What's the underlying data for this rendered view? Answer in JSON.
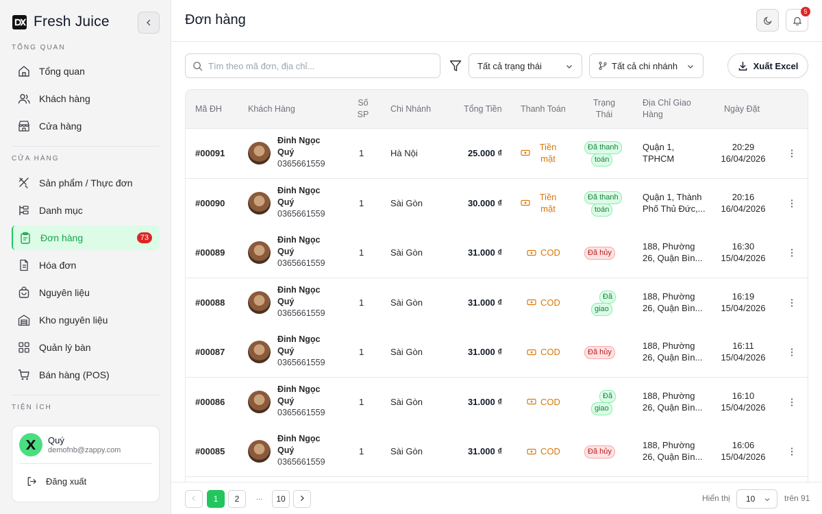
{
  "brand": {
    "name": "Fresh Juice"
  },
  "sidebar": {
    "sections": [
      "Tổng quan",
      "Cửa hàng",
      "Tiện ích"
    ],
    "overview_items": [
      {
        "label": "Tổng quan",
        "icon": "home-icon"
      },
      {
        "label": "Khách hàng",
        "icon": "users-icon"
      },
      {
        "label": "Cửa hàng",
        "icon": "store-icon"
      }
    ],
    "store_items": [
      {
        "label": "Sản phẩm / Thực đơn",
        "icon": "utensils-icon"
      },
      {
        "label": "Danh mục",
        "icon": "category-icon"
      },
      {
        "label": "Đơn hàng",
        "icon": "clipboard-icon",
        "active": true,
        "badge": "73"
      },
      {
        "label": "Hóa đơn",
        "icon": "invoice-icon"
      },
      {
        "label": "Nguyên liệu",
        "icon": "bag-icon"
      },
      {
        "label": "Kho nguyên liệu",
        "icon": "warehouse-icon"
      },
      {
        "label": "Quản lý bàn",
        "icon": "grid-icon"
      },
      {
        "label": "Bán hàng (POS)",
        "icon": "cart-icon"
      }
    ]
  },
  "user": {
    "name": "Quý",
    "email": "demofnb@zappy.com",
    "logout_label": "Đăng xuất"
  },
  "header": {
    "title": "Đơn hàng",
    "notification_count": "5"
  },
  "toolbar": {
    "search_placeholder": "Tìm theo mã đơn, địa chỉ...",
    "status_filter": "Tất cả trạng thái",
    "branch_filter": "Tất cả chi nhánh",
    "export_label": "Xuất Excel"
  },
  "table": {
    "columns": {
      "id": "Mã ĐH",
      "customer": "Khách Hàng",
      "qty_1": "Số",
      "qty_2": "SP",
      "branch": "Chi Nhánh",
      "total": "Tổng Tiền",
      "payment": "Thanh Toán",
      "status_1": "Trạng",
      "status_2": "Thái",
      "address_1": "Địa Chỉ Giao",
      "address_2": "Hàng",
      "date": "Ngày Đặt"
    },
    "rows": [
      {
        "id": "#00091",
        "name_1": "Đinh Ngọc",
        "name_2": "Quý",
        "phone": "0365661559",
        "qty": "1",
        "branch": "Hà Nội",
        "total": "25.000 ₫",
        "pay_1": "Tiền",
        "pay_2": "mặt",
        "status_1": "Đã thanh",
        "status_2": "toán",
        "status_kind": "paid",
        "addr_1": "Quận 1,",
        "addr_2": "TPHCM",
        "time": "20:29",
        "date": "16/04/2026"
      },
      {
        "id": "#00090",
        "name_1": "Đinh Ngọc",
        "name_2": "Quý",
        "phone": "0365661559",
        "qty": "1",
        "branch": "Sài Gòn",
        "total": "30.000 ₫",
        "pay_1": "Tiền",
        "pay_2": "mặt",
        "status_1": "Đã thanh",
        "status_2": "toán",
        "status_kind": "paid",
        "addr_1": "Quận 1, Thành",
        "addr_2": "Phố Thủ Đức,...",
        "time": "20:16",
        "date": "16/04/2026"
      },
      {
        "id": "#00089",
        "name_1": "Đinh Ngọc",
        "name_2": "Quý",
        "phone": "0365661559",
        "qty": "1",
        "branch": "Sài Gòn",
        "total": "31.000 ₫",
        "pay_1": "COD",
        "pay_2": "",
        "status_1": "Đã hủy",
        "status_2": "",
        "status_kind": "cancel",
        "addr_1": "188, Phường",
        "addr_2": "26, Quận Bìn...",
        "time": "16:30",
        "date": "15/04/2026"
      },
      {
        "id": "#00088",
        "name_1": "Đinh Ngọc",
        "name_2": "Quý",
        "phone": "0365661559",
        "qty": "1",
        "branch": "Sài Gòn",
        "total": "31.000 ₫",
        "pay_1": "COD",
        "pay_2": "",
        "status_1": "Đã",
        "status_2": "giao",
        "status_kind": "delivered",
        "addr_1": "188, Phường",
        "addr_2": "26, Quận Bìn...",
        "time": "16:19",
        "date": "15/04/2026"
      },
      {
        "id": "#00087",
        "name_1": "Đinh Ngọc",
        "name_2": "Quý",
        "phone": "0365661559",
        "qty": "1",
        "branch": "Sài Gòn",
        "total": "31.000 ₫",
        "pay_1": "COD",
        "pay_2": "",
        "status_1": "Đã hủy",
        "status_2": "",
        "status_kind": "cancel",
        "addr_1": "188, Phường",
        "addr_2": "26, Quận Bìn...",
        "time": "16:11",
        "date": "15/04/2026"
      },
      {
        "id": "#00086",
        "name_1": "Đinh Ngọc",
        "name_2": "Quý",
        "phone": "0365661559",
        "qty": "1",
        "branch": "Sài Gòn",
        "total": "31.000 ₫",
        "pay_1": "COD",
        "pay_2": "",
        "status_1": "Đã",
        "status_2": "giao",
        "status_kind": "delivered",
        "addr_1": "188, Phường",
        "addr_2": "26, Quận Bìn...",
        "time": "16:10",
        "date": "15/04/2026"
      },
      {
        "id": "#00085",
        "name_1": "Đinh Ngọc",
        "name_2": "Quý",
        "phone": "0365661559",
        "qty": "1",
        "branch": "Sài Gòn",
        "total": "31.000 ₫",
        "pay_1": "COD",
        "pay_2": "",
        "status_1": "Đã hủy",
        "status_2": "",
        "status_kind": "cancel",
        "addr_1": "188, Phường",
        "addr_2": "26, Quận Bìn...",
        "time": "16:06",
        "date": "15/04/2026"
      }
    ]
  },
  "pagination": {
    "pages": [
      "1",
      "2",
      "10"
    ],
    "current": "1",
    "ellipsis": "...",
    "per_page_label": "Hiển thị",
    "per_page": "10",
    "total_label": "trên 91"
  },
  "colors": {
    "accent": "#22c55e",
    "danger": "#dc2626",
    "warning": "#d97706"
  }
}
